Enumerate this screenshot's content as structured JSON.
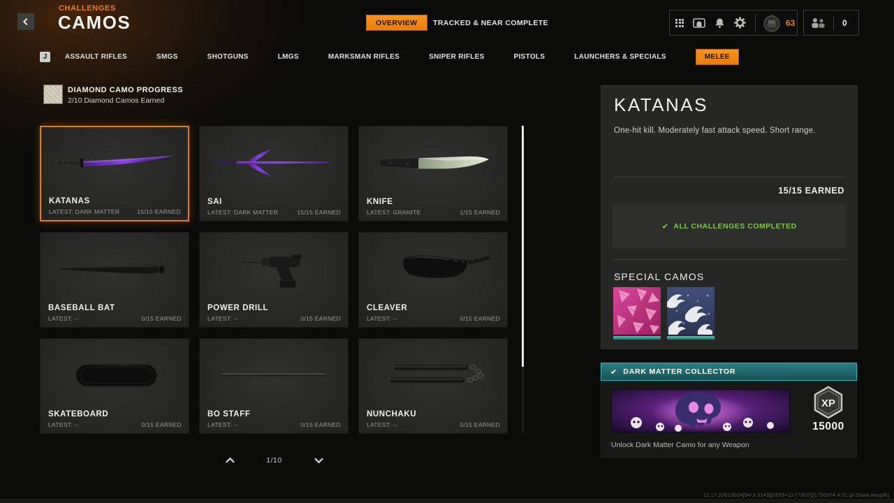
{
  "header": {
    "eyebrow": "CHALLENGES",
    "title": "CAMOS",
    "view_tabs": {
      "overview": "OVERVIEW",
      "tracked": "TRACKED & NEAR COMPLETE"
    },
    "hud": {
      "rank_value": "63",
      "friends_count": "0"
    }
  },
  "icons": {
    "check": "✔",
    "names": [
      "back-chevron",
      "grid",
      "store",
      "bell",
      "gear",
      "rank-emblem",
      "friends",
      "scroll-up-chevron",
      "scroll-down-chevron",
      "xp-hexagon",
      "diamond-camo-swatch"
    ]
  },
  "category_bar": {
    "key_hint": "J",
    "tabs": [
      {
        "label": "ASSAULT RIFLES",
        "active": false
      },
      {
        "label": "SMGS",
        "active": false
      },
      {
        "label": "SHOTGUNS",
        "active": false
      },
      {
        "label": "LMGS",
        "active": false
      },
      {
        "label": "MARKSMAN RIFLES",
        "active": false
      },
      {
        "label": "SNIPER RIFLES",
        "active": false
      },
      {
        "label": "PISTOLS",
        "active": false
      },
      {
        "label": "LAUNCHERS & SPECIALS",
        "active": false
      },
      {
        "label": "MELEE",
        "active": true
      }
    ]
  },
  "progress": {
    "title": "DIAMOND CAMO PROGRESS",
    "subtitle": "2/10 Diamond Camos Earned"
  },
  "weapons": [
    {
      "name": "KATANAS",
      "latest": "LATEST: DARK MATTER",
      "earned": "15/15 EARNED",
      "selected": true,
      "art": "katana"
    },
    {
      "name": "SAI",
      "latest": "LATEST: DARK MATTER",
      "earned": "15/15 EARNED",
      "selected": false,
      "art": "sai"
    },
    {
      "name": "KNIFE",
      "latest": "LATEST: GRANITE",
      "earned": "1/15 EARNED",
      "selected": false,
      "art": "knife"
    },
    {
      "name": "BASEBALL BAT",
      "latest": "LATEST: --",
      "earned": "0/15 EARNED",
      "selected": false,
      "art": "bat"
    },
    {
      "name": "POWER DRILL",
      "latest": "LATEST: --",
      "earned": "0/15 EARNED",
      "selected": false,
      "art": "drill"
    },
    {
      "name": "CLEAVER",
      "latest": "LATEST: --",
      "earned": "0/15 EARNED",
      "selected": false,
      "art": "cleaver"
    },
    {
      "name": "SKATEBOARD",
      "latest": "LATEST: --",
      "earned": "0/15 EARNED",
      "selected": false,
      "art": "skateboard"
    },
    {
      "name": "BO STAFF",
      "latest": "LATEST: --",
      "earned": "0/15 EARNED",
      "selected": false,
      "art": "bostaff"
    },
    {
      "name": "NUNCHAKU",
      "latest": "LATEST: --",
      "earned": "0/15 EARNED",
      "selected": false,
      "art": "nunchaku"
    }
  ],
  "pagination": {
    "page": "1/10"
  },
  "detail": {
    "title": "KATANAS",
    "description": "One-hit kill.  Moderately fast attack speed. Short range.",
    "earned": "15/15 EARNED",
    "completed": "ALL CHALLENGES COMPLETED",
    "special_camos_title": "SPECIAL CAMOS",
    "special_camos": [
      "pink-petals-camo",
      "wave-camo"
    ]
  },
  "collector": {
    "title": "DARK MATTER COLLECTOR",
    "xp_label": "XP",
    "xp_value": "15000",
    "unlock_text": "Unlock Dark Matter Camo for any Weapon"
  },
  "footer": {
    "version": "11.17.22613024[94-3.3145][0553+11-[7300]][1750974.4.01.pl.Gaaa.wingdk]"
  },
  "colors": {
    "accent_orange": "#ef8318",
    "teal": "#2ba7a0",
    "completed_green": "#79cc41",
    "rank_orange": "#e08418"
  }
}
